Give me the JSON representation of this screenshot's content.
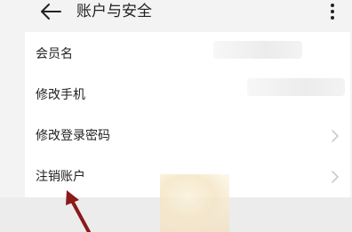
{
  "header": {
    "title": "账户与安全",
    "back_icon": "arrow-left-icon",
    "more_icon": "more-vertical-icon"
  },
  "settings": {
    "rows": [
      {
        "label": "会员名",
        "value_hidden": true
      },
      {
        "label": "修改手机",
        "value_hidden": true
      },
      {
        "label": "修改登录密码",
        "chevron": true
      },
      {
        "label": "注销账户",
        "chevron": true
      }
    ]
  },
  "annotation": {
    "arrow_color": "#8b1a1a",
    "target": "注销账户"
  },
  "colors": {
    "background": "#f3f3f3",
    "card": "#ffffff",
    "chevron": "#c4c4c4"
  }
}
